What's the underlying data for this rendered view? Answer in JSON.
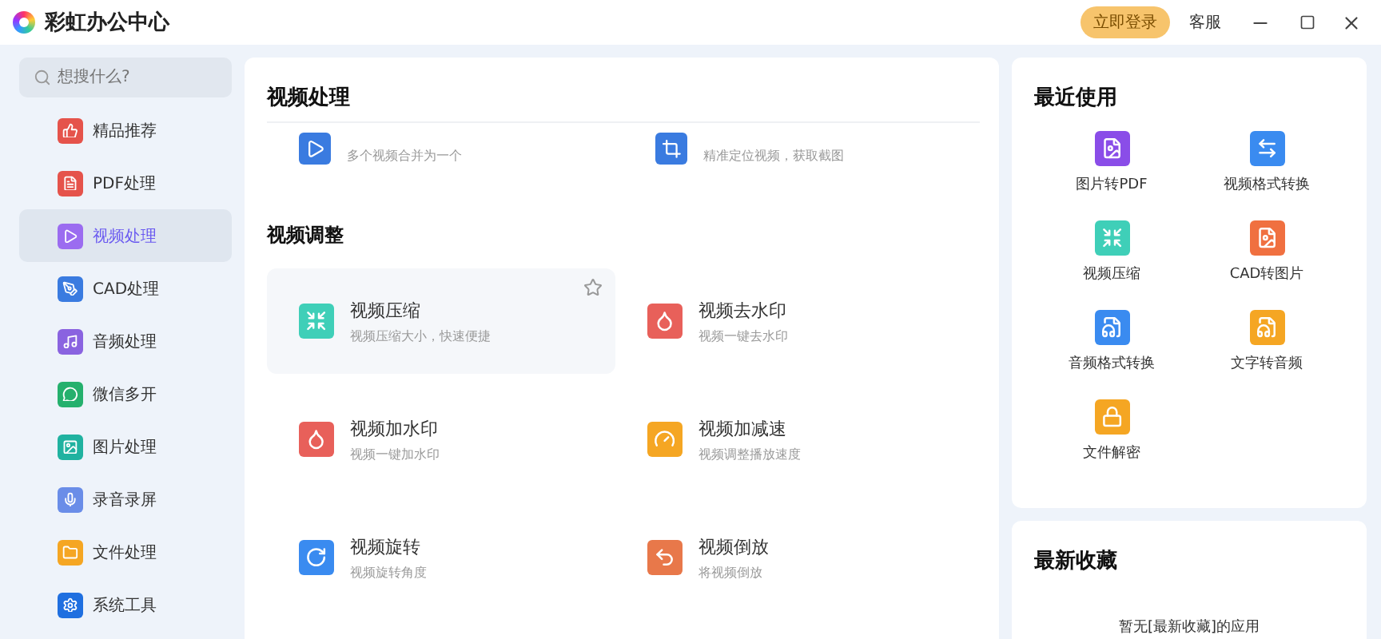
{
  "window": {
    "title": "彩虹办公中心",
    "login_button": "立即登录",
    "service_link": "客服"
  },
  "sidebar": {
    "search": {
      "placeholder": "想搜什么?"
    },
    "items": [
      {
        "label": "精品推荐",
        "selected": false
      },
      {
        "label": "PDF处理",
        "selected": false
      },
      {
        "label": "视频处理",
        "selected": true
      },
      {
        "label": "CAD处理",
        "selected": false
      },
      {
        "label": "音频处理",
        "selected": false
      },
      {
        "label": "微信多开",
        "selected": false
      },
      {
        "label": "图片处理",
        "selected": false
      },
      {
        "label": "录音录屏",
        "selected": false
      },
      {
        "label": "文件处理",
        "selected": false
      },
      {
        "label": "系统工具",
        "selected": false
      }
    ]
  },
  "main": {
    "title": "视频处理",
    "partial_row": [
      {
        "description": "多个视频合并为一个"
      },
      {
        "description": "精准定位视频，获取截图"
      }
    ],
    "sections": [
      {
        "title": "视频调整",
        "tools": [
          {
            "name": "视频压缩",
            "description": "视频压缩大小，快速便捷",
            "hovered": true
          },
          {
            "name": "视频去水印",
            "description": "视频一键去水印",
            "hovered": false
          },
          {
            "name": "视频加水印",
            "description": "视频一键加水印",
            "hovered": false
          },
          {
            "name": "视频加减速",
            "description": "视频调整播放速度",
            "hovered": false
          },
          {
            "name": "视频旋转",
            "description": "视频旋转角度",
            "hovered": false
          },
          {
            "name": "视频倒放",
            "description": "将视频倒放",
            "hovered": false
          }
        ]
      }
    ]
  },
  "recent": {
    "title": "最近使用",
    "items": [
      {
        "label": "图片转PDF"
      },
      {
        "label": "视频格式转换"
      },
      {
        "label": "视频压缩"
      },
      {
        "label": "CAD转图片"
      },
      {
        "label": "音频格式转换"
      },
      {
        "label": "文字转音频"
      },
      {
        "label": "文件解密"
      }
    ]
  },
  "favorites": {
    "title": "最新收藏",
    "empty_text": "暂无[最新收藏]的应用"
  }
}
